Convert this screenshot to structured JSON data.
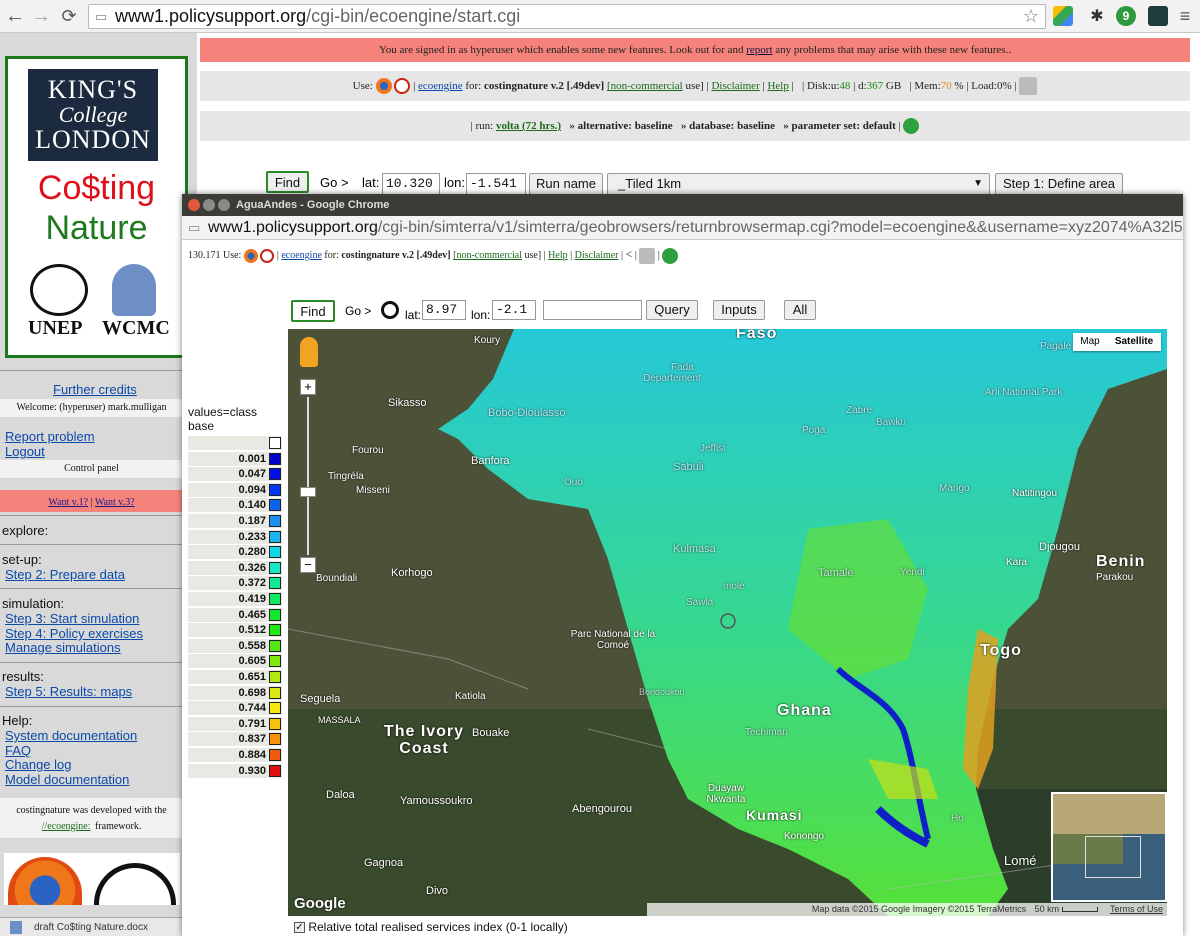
{
  "browser": {
    "url_host": "www1.policysupport.org",
    "url_path": "/cgi-bin/ecoengine/start.cgi"
  },
  "sidebar": {
    "logo": {
      "kcl_line1": "KING'S",
      "kcl_line2": "College",
      "kcl_line3": "LONDON",
      "costing": "Co$ting",
      "nature": "Nature",
      "unep": "UNEP",
      "wcmc": "WCMC"
    },
    "further_credits": "Further credits",
    "welcome": "Welcome: (hyperuser) mark.mulligan",
    "report_problem": "Report problem",
    "logout": "Logout",
    "control_panel": "Control panel",
    "want_v1": "Want v.1?",
    "want_v3": "Want v.3?",
    "explore": "explore:",
    "setup": "set-up:",
    "step2": "Step 2: Prepare data",
    "simulation": "simulation:",
    "step3": "Step 3: Start simulation",
    "step4": "Step 4: Policy exercises",
    "manage": "Manage simulations",
    "results": "results:",
    "step5": "Step 5: Results: maps",
    "help": "Help:",
    "sysdoc": "System documentation",
    "faq": "FAQ",
    "changelog": "Change log",
    "modeldoc": "Model documentation",
    "developed": "costingnature was developed with the",
    "framework_link": "//ecoengine:",
    "framework_word": "framework.",
    "taskbar_item": "draft Co$ting Nature.docx"
  },
  "notice": {
    "text_before": "You are signed in as hyperuser which enables some new features. Look out for and",
    "report_link": "report",
    "text_after": "any problems that may arise with these new features.."
  },
  "use_bar": {
    "use": "Use:",
    "ecoengine": "ecoengine",
    "for_label": "for:",
    "product": "costingnature v.2 [.49dev]",
    "noncommercial": "[non-commercial",
    "use_close": "use]",
    "disclaimer": "Disclaimer",
    "help": "Help",
    "disk_label": "Disk:u:",
    "disk_u": "48",
    "disk_d_label": "d:",
    "disk_d": "367",
    "gb": "GB",
    "mem_label": "Mem:",
    "mem": "70",
    "percent": "%",
    "load_label": "Load:",
    "load": "0%"
  },
  "run_bar": {
    "run_label": "run:",
    "run_link": "volta (72 hrs.)",
    "alternative": "» alternative: baseline",
    "database": "» database: baseline",
    "paramset": "» parameter set: default"
  },
  "find_row": {
    "find": "Find",
    "goto": "Go >",
    "lat_label": "lat:",
    "lat": "10.320",
    "lon_label": "lon:",
    "lon": "-1.541",
    "run_name": "Run name",
    "tile_select": "_Tiled 1km",
    "step1": "Step 1: Define area"
  },
  "popup": {
    "title": "AguaAndes - Google Chrome",
    "url_host": "www1.policysupport.org",
    "url_path": "/cgi-bin/simterra/v1/simterra/geobrowsers/returnbrowsermap.cgi?model=ecoengine&&username=xyz2074%A32l5",
    "use_prefix": "130.171 Use:",
    "ecoengine": "ecoengine",
    "for_label": "for:",
    "product": "costingnature v.2 [.49dev]",
    "noncommercial": "[non-commercial",
    "use_close": "use]",
    "help": "Help",
    "disclaimer": "Disclaimer",
    "find": "Find",
    "goto": "Go >",
    "lat_label": "lat:",
    "lat": "8.97",
    "lon_label": "lon:",
    "lon": "-2.1",
    "query": "Query",
    "inputs": "Inputs",
    "all": "All",
    "legend_title": "values=class",
    "legend_subtitle": "base",
    "legend": [
      {
        "value": "",
        "color": "#ffffff"
      },
      {
        "value": "0.001",
        "color": "#0000c8"
      },
      {
        "value": "0.047",
        "color": "#0010e6"
      },
      {
        "value": "0.094",
        "color": "#0038f4"
      },
      {
        "value": "0.140",
        "color": "#0a64f0"
      },
      {
        "value": "0.187",
        "color": "#1a90f0"
      },
      {
        "value": "0.233",
        "color": "#1ab4f0"
      },
      {
        "value": "0.280",
        "color": "#10d8e8"
      },
      {
        "value": "0.326",
        "color": "#10e8c8"
      },
      {
        "value": "0.372",
        "color": "#10e894"
      },
      {
        "value": "0.419",
        "color": "#10e860"
      },
      {
        "value": "0.465",
        "color": "#10e830"
      },
      {
        "value": "0.512",
        "color": "#20e810"
      },
      {
        "value": "0.558",
        "color": "#50e810"
      },
      {
        "value": "0.605",
        "color": "#80e810"
      },
      {
        "value": "0.651",
        "color": "#b0e810"
      },
      {
        "value": "0.698",
        "color": "#d8e810"
      },
      {
        "value": "0.744",
        "color": "#f8e810"
      },
      {
        "value": "0.791",
        "color": "#f8c010"
      },
      {
        "value": "0.837",
        "color": "#f89010"
      },
      {
        "value": "0.884",
        "color": "#f05a10"
      },
      {
        "value": "0.930",
        "color": "#e01010"
      }
    ],
    "map": {
      "map_btn": "Map",
      "satellite_btn": "Satellite",
      "attribution": "Map data ©2015 Google Imagery ©2015 TerraMetrics",
      "scale": "50 km",
      "terms": "Terms of Use",
      "google": "Google",
      "labels": {
        "faso": "Faso",
        "koury": "Koury",
        "sikasso": "Sikasso",
        "bobo": "Bobo-Dioulasso",
        "fada": "Fada",
        "departement": "Département",
        "pagale": "Pagale",
        "arli": "Arli National Park",
        "zabre": "Zabre",
        "bawku": "Bawku",
        "poga": "Poga",
        "fourou": "Fourou",
        "banfora": "Banfora",
        "jeffisi": "Jeffisi",
        "sabuli": "Sabuli",
        "tingrela": "Tingréla",
        "misseni": "Misseni",
        "ouo": "Ouo",
        "mango": "Mango",
        "natitingou": "Natitingou",
        "kulmasa": "Kulmasa",
        "djougou": "Djougou",
        "boundiali": "Boundiali",
        "korhogo": "Korhogo",
        "tamale": "Tamale",
        "yendi": "Yendi",
        "kara": "Kara",
        "benin": "Benin",
        "parakou": "Parakou",
        "mole": "mole",
        "sawla": "Sawla",
        "comoe": "Parc National de la Comoé",
        "togo": "Togo",
        "seguela": "Seguela",
        "katiola": "Katiola",
        "bondoukou": "Bondoukou",
        "ghana": "Ghana",
        "massala": "MASSALA",
        "ivory": "The Ivory Coast",
        "bouake": "Bouake",
        "techiman": "Techiman",
        "daloa": "Daloa",
        "yamoussoukro": "Yamoussoukro",
        "duayaw": "Duayaw Nkwanta",
        "abengourou": "Abengourou",
        "kumasi": "Kumasi",
        "konongo": "Konongo",
        "gagnoa": "Gagnoa",
        "divo": "Divo",
        "lome": "Lomé",
        "ho": "Ho"
      }
    },
    "checkbox_label": "Relative total realised services index (0-1 locally)"
  }
}
